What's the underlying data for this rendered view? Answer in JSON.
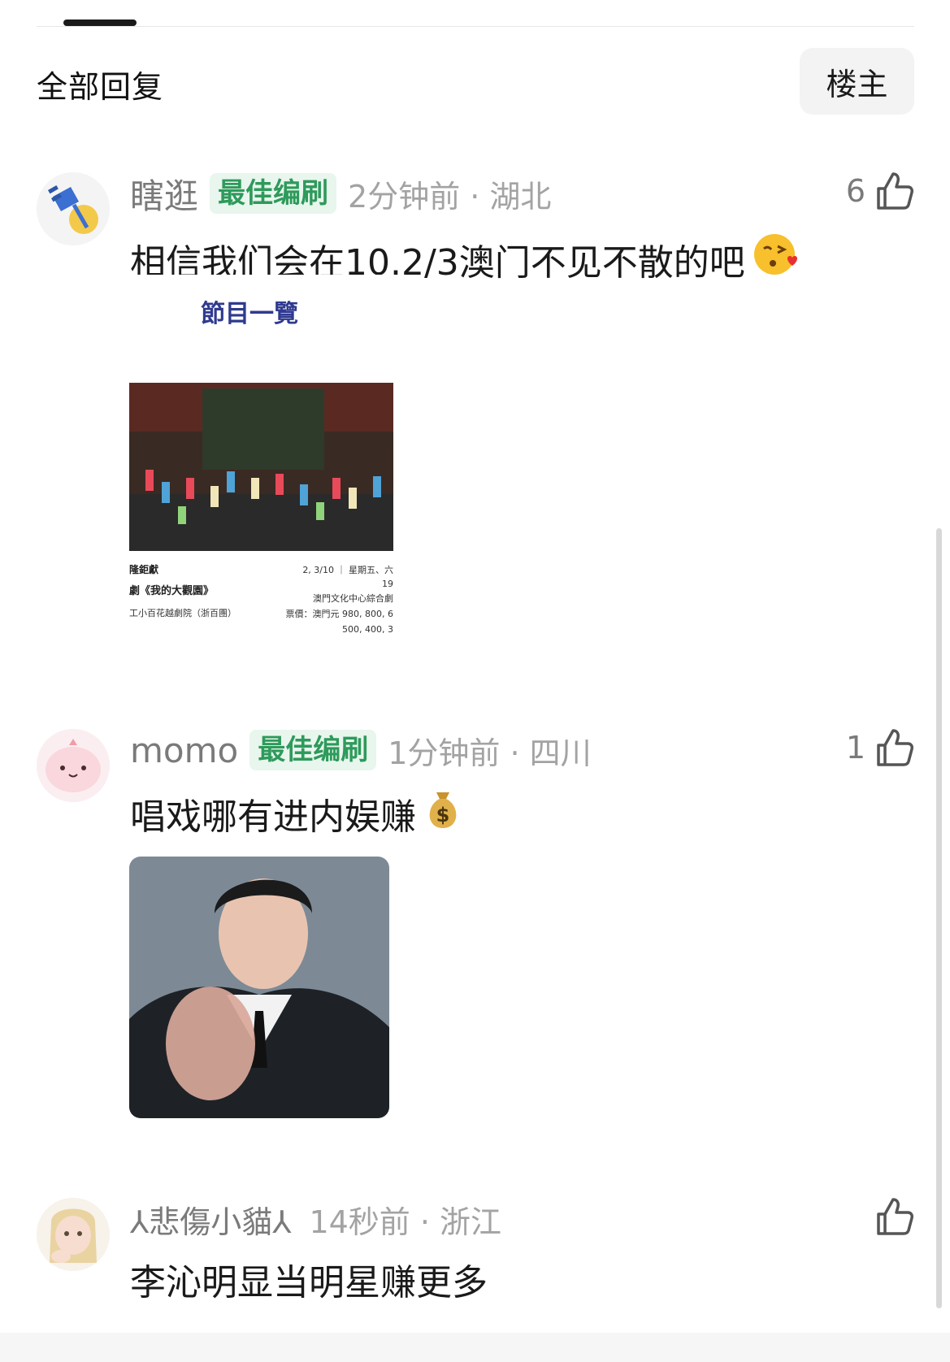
{
  "header": {
    "title": "全部回复",
    "owner_button": "楼主"
  },
  "comments": [
    {
      "username": "瞎逛",
      "badge": "最佳编刷",
      "time_location": "2分钟前 · 湖北",
      "likes": "6",
      "text": "相信我们会在10.2/3澳门不见不散的吧",
      "image": {
        "heading": "節目一覽",
        "left_lines": [
          "隆鉅獻",
          "劇《我的大觀園》",
          "工小百花越劇院（浙百團）"
        ],
        "right_lines": [
          "2, 3/10 ｜ 星期五、六",
          "19",
          "澳門文化中心綜合劇",
          "票價：澳門元 980, 800, 6",
          "500, 400, 3"
        ]
      }
    },
    {
      "username": "momo",
      "badge": "最佳编刷",
      "time_location": "1分钟前 · 四川",
      "likes": "1",
      "text": "唱戏哪有进内娱赚"
    },
    {
      "username": "⅄悲傷小貓⅄",
      "time_location": "14秒前 · 浙江",
      "likes": "",
      "text": "李沁明显当明星赚更多"
    }
  ],
  "icons": {
    "like": "thumbs-up-icon",
    "kiss_emoji": "face-blowing-kiss-icon",
    "money_emoji": "money-bag-icon"
  }
}
